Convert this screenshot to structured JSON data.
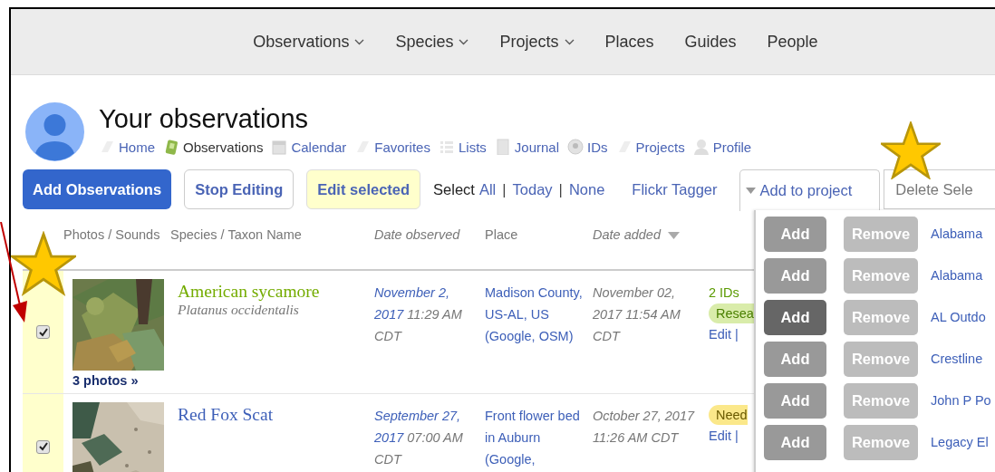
{
  "nav": [
    {
      "label": "Observations",
      "dropdown": true
    },
    {
      "label": "Species",
      "dropdown": true
    },
    {
      "label": "Projects",
      "dropdown": true
    },
    {
      "label": "Places",
      "dropdown": false
    },
    {
      "label": "Guides",
      "dropdown": false
    },
    {
      "label": "People",
      "dropdown": false
    }
  ],
  "profile": {
    "title": "Your observations",
    "links": [
      {
        "label": "Home",
        "selected": false
      },
      {
        "label": "Observations",
        "selected": true
      },
      {
        "label": "Calendar",
        "selected": false
      },
      {
        "label": "Favorites",
        "selected": false
      },
      {
        "label": "Lists",
        "selected": false
      },
      {
        "label": "Journal",
        "selected": false
      },
      {
        "label": "IDs",
        "selected": false
      },
      {
        "label": "Projects",
        "selected": false
      },
      {
        "label": "Profile",
        "selected": false
      }
    ]
  },
  "toolbar": {
    "add_button": "Add Observations",
    "stop_button": "Stop Editing",
    "edit_selected_button": "Edit selected",
    "select_label": "Select",
    "select_links": [
      "All",
      "Today",
      "None"
    ],
    "select_separator": "|",
    "flickr_link": "Flickr Tagger",
    "add_to_project": "Add to project",
    "delete_field": "Delete Sele"
  },
  "table": {
    "columns": [
      {
        "label": "Photos / Sounds",
        "italic": false,
        "sorted": false
      },
      {
        "label": "Species / Taxon Name",
        "italic": false,
        "sorted": false
      },
      {
        "label": "Date observed",
        "italic": true,
        "sorted": false
      },
      {
        "label": "Place",
        "italic": false,
        "sorted": false
      },
      {
        "label": "Date added",
        "italic": true,
        "sorted": true
      }
    ],
    "rows": [
      {
        "selected": true,
        "photo_link": "3 photos »",
        "common_name": "American sycamore",
        "scientific_name": "Platanus occidentalis",
        "research_grade": true,
        "date_link": "November 2, 2017",
        "time": "11:29 AM CDT",
        "place": "Madison County, US-AL, US",
        "map_links": "(Google, OSM)",
        "date_added": "November 02, 2017 11:54 AM CDT",
        "ids": "2 IDs",
        "badge": "Resea",
        "edit": "Edit |"
      },
      {
        "selected": true,
        "common_name": "Red Fox Scat",
        "research_grade": false,
        "date_link": "September 27, 2017",
        "time": "07:00 AM CDT",
        "place": "Front flower bed in Auburn",
        "map_links": "(Google,",
        "date_added": "October 27, 2017 11:26 AM CDT",
        "badge": "Need",
        "edit": "Edit |"
      }
    ]
  },
  "project_menu": {
    "items": [
      {
        "add": "Add",
        "remove": "Remove",
        "project": "Alabama",
        "hovered": false
      },
      {
        "add": "Add",
        "remove": "Remove",
        "project": "Alabama",
        "hovered": false
      },
      {
        "add": "Add",
        "remove": "Remove",
        "project": "AL Outdo",
        "hovered": true
      },
      {
        "add": "Add",
        "remove": "Remove",
        "project": "Crestline",
        "hovered": false
      },
      {
        "add": "Add",
        "remove": "Remove",
        "project": "John P Po",
        "hovered": false
      },
      {
        "add": "Add",
        "remove": "Remove",
        "project": "Legacy El",
        "hovered": false
      }
    ]
  },
  "annotations": [
    {
      "kind": "star"
    },
    {
      "kind": "star"
    },
    {
      "kind": "arrow"
    }
  ]
}
